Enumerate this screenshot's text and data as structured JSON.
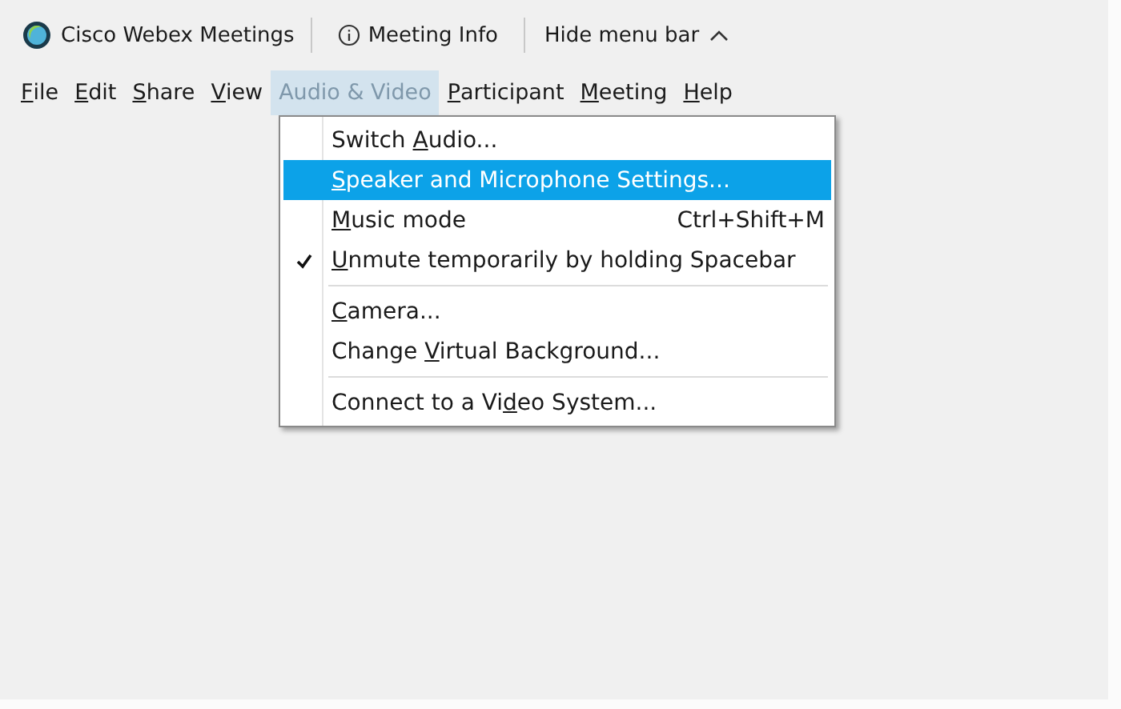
{
  "title_bar": {
    "app_name": "Cisco Webex Meetings",
    "meeting_info": "Meeting Info",
    "hide_menu": "Hide menu bar"
  },
  "menu_bar": [
    {
      "label": {
        "key": "F",
        "post": "ile"
      },
      "selected": false
    },
    {
      "label": {
        "key": "E",
        "post": "dit"
      },
      "selected": false
    },
    {
      "label": {
        "key": "S",
        "post": "hare"
      },
      "selected": false
    },
    {
      "label": {
        "key": "V",
        "post": "iew"
      },
      "selected": false
    },
    {
      "label": {
        "pre": "Audio & Video"
      },
      "selected": true
    },
    {
      "label": {
        "key": "P",
        "post": "articipant"
      },
      "selected": false
    },
    {
      "label": {
        "key": "M",
        "post": "eeting"
      },
      "selected": false
    },
    {
      "label": {
        "key": "H",
        "post": "elp"
      },
      "selected": false
    }
  ],
  "dropdown": [
    {
      "kind": "item",
      "label": {
        "pre": "Switch ",
        "key": "A",
        "post": "udio..."
      },
      "selected": false,
      "checked": false
    },
    {
      "kind": "item",
      "label": {
        "key": "S",
        "post": "peaker and Microphone Settings..."
      },
      "selected": true,
      "checked": false
    },
    {
      "kind": "item",
      "label": {
        "key": "M",
        "post": "usic mode"
      },
      "shortcut": "Ctrl+Shift+M",
      "selected": false,
      "checked": false
    },
    {
      "kind": "item",
      "label": {
        "key": "U",
        "post": "nmute temporarily by holding Spacebar"
      },
      "selected": false,
      "checked": true
    },
    {
      "kind": "separator"
    },
    {
      "kind": "item",
      "label": {
        "key": "C",
        "post": "amera..."
      },
      "selected": false,
      "checked": false
    },
    {
      "kind": "item",
      "label": {
        "pre": "Change ",
        "key": "V",
        "post": "irtual Background..."
      },
      "selected": false,
      "checked": false
    },
    {
      "kind": "separator"
    },
    {
      "kind": "item",
      "label": {
        "pre": "Connect to a Vi",
        "key": "d",
        "post": "eo System..."
      },
      "selected": false,
      "checked": false
    }
  ]
}
